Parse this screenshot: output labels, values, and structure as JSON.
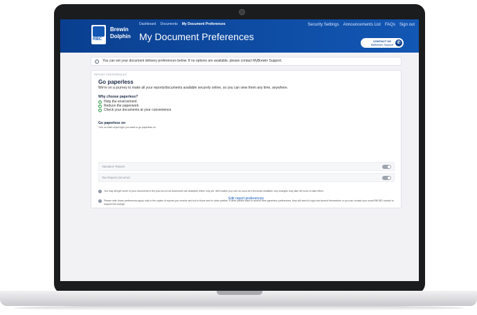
{
  "header": {
    "logo_text": "RBC",
    "brand_line1": "Brewin",
    "brand_line2": "Dolphin",
    "nav": [
      "Dashboard",
      "Documents",
      "My Document Preferences"
    ],
    "page_title": "My Document Preferences",
    "right_nav": [
      "Security Settings",
      "Announcements List",
      "FAQs",
      "Sign out"
    ],
    "contact_line1": "CONTACT US",
    "contact_line2": "MyBrewin Support"
  },
  "info": {
    "text": "You can set your document delivery preferences below. If no options are available, please contact MyBrewin Support."
  },
  "card": {
    "section_label": "REPORT PREFERENCES",
    "heading": "Go paperless",
    "intro": "We're on a journey to make all your reports/documents available securely online, so you can view them any time, anywhere.",
    "why_heading": "Why choose paperless?",
    "reasons": [
      "Help the environment",
      "Reduce the paperwork",
      "Check your documents at your convenience"
    ],
    "paperless_on": "Go paperless on",
    "paperless_hint": "Turn on each report type you want to go paperless on",
    "toggles": [
      {
        "label": "Valuation Report",
        "on": true
      },
      {
        "label": "Tax Report (Income)",
        "on": true
      }
    ],
    "note1": "You may still get some of your documents in the post as not all documents are available online only yet. We'll switch you over as soon as it becomes available. Any changes may take 48 hours to take effect.",
    "note2": "Please note: these preferences apply only to the copies of reports you receive and not to those sent to other parties. If other parties want to amend their paperless preferences, they will need to login and amend themselves or you can contact your usual RBCBD contact to request the change.",
    "edit_link": "Edit report preferences"
  }
}
